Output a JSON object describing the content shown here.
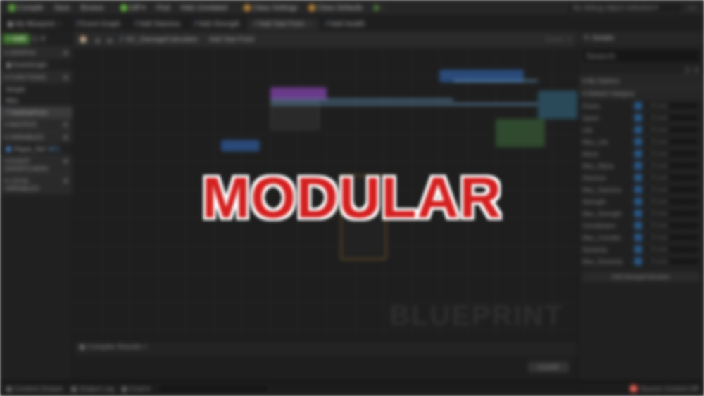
{
  "overlay_text": "MODULAR",
  "toolbar": {
    "compile": "Compile",
    "save": "Save",
    "browse": "Browse",
    "diff": "Diff",
    "find": "Find",
    "hide_unrelated": "Hide Unrelated",
    "class_settings": "Class Settings",
    "class_defaults": "Class Defaults",
    "debug_selector": "No debug object selected"
  },
  "tabs": [
    {
      "label": "My Blueprint",
      "active": false,
      "closable": true,
      "icon": "panel"
    },
    {
      "label": "Event Graph",
      "active": false,
      "fx": true
    },
    {
      "label": "Add Stamina",
      "active": false,
      "fx": true
    },
    {
      "label": "Add Strength",
      "active": false,
      "fx": true
    },
    {
      "label": "Add Stat Point",
      "active": true,
      "fx": true,
      "closable": true
    },
    {
      "label": "Add Health",
      "active": false,
      "fx": true
    }
  ],
  "breadcrumb": {
    "root": "AC_DamageCalculator",
    "leaf": "Add Stat Point",
    "zoom": "Zoom  -4"
  },
  "left": {
    "add": "+ Add",
    "sections": [
      {
        "title": "GRAPHS",
        "items": [
          {
            "label": "EventGraph",
            "icon": "graph"
          }
        ]
      },
      {
        "title": "FUNCTIONS",
        "items": [
          {
            "label": "Simple"
          },
          {
            "label": "Misc"
          },
          {
            "label": "AddStatPoint",
            "sel": true,
            "fx": true
          }
        ]
      },
      {
        "title": "MACROS",
        "items": []
      },
      {
        "title": "VARIABLES",
        "items": [
          {
            "label": "Player_Ref",
            "pill": true,
            "extra": "BP1"
          }
        ]
      },
      {
        "title": "EVENT DISPATCHERS",
        "items": []
      },
      {
        "title": "LOCAL VARIABLES",
        "items": []
      }
    ]
  },
  "details": {
    "title": "Details",
    "search_placeholder": "Search",
    "cats": [
      {
        "title": "My Options",
        "props": []
      },
      {
        "title": "Default Category",
        "props": [
          {
            "label": "Points",
            "val": "24 pnts"
          },
          {
            "label": "Spent",
            "val": "24 pnts"
          },
          {
            "label": "Life",
            "val": "24 pnts"
          },
          {
            "label": "Max_Life",
            "val": "24 pnts"
          },
          {
            "label": "Mana",
            "val": "24 pnts"
          },
          {
            "label": "Max_Mana",
            "val": "24 pnts"
          },
          {
            "label": "Stamina",
            "val": "24 pnts"
          },
          {
            "label": "Max_Stamina",
            "val": "24 pnts"
          },
          {
            "label": "Strength",
            "val": "24 pnts"
          },
          {
            "label": "Max_Strength",
            "val": "24 pnts"
          },
          {
            "label": "Constitution",
            "val": "24 pnts"
          },
          {
            "label": "Max_Constitu",
            "val": "24 pnts"
          },
          {
            "label": "Dexterity",
            "val": "24 pnts"
          },
          {
            "label": "Max_Dexterity",
            "val": "24 pnts"
          }
        ],
        "button": "Edit DamageCalculator"
      }
    ]
  },
  "compiler_results": "Compiler Results",
  "watermark": "BLUEPRINT",
  "clear": "CLEAR",
  "status": {
    "content_drawer": "Content Drawer",
    "output_log": "Output Log",
    "cmd": "Cmd",
    "source_control": "Source Control Off"
  }
}
